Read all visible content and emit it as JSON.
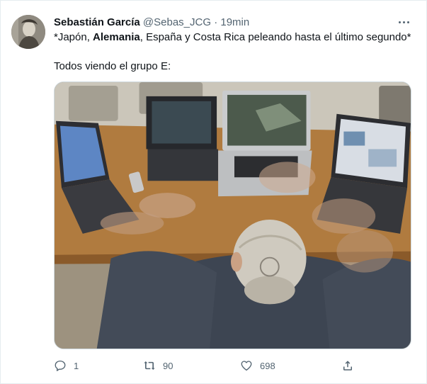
{
  "tweet": {
    "display_name": "Sebastián García",
    "handle": "@Sebas_JCG",
    "separator": "·",
    "timestamp": "19min",
    "text_parts": [
      {
        "text": "*Japón, ",
        "bold": false
      },
      {
        "text": "Alemania",
        "bold": true
      },
      {
        "text": ", España y Costa Rica peleando hasta el último segundo*",
        "bold": false
      }
    ],
    "text_line2": "Todos viendo el grupo E:"
  },
  "actions": {
    "reply": {
      "icon": "reply-icon",
      "count": "1"
    },
    "retweet": {
      "icon": "retweet-icon",
      "count": "90"
    },
    "like": {
      "icon": "heart-icon",
      "count": "698"
    },
    "share": {
      "icon": "share-icon"
    }
  },
  "colors": {
    "text_primary": "#0f1419",
    "text_secondary": "#536471",
    "border": "#cfd9de"
  }
}
